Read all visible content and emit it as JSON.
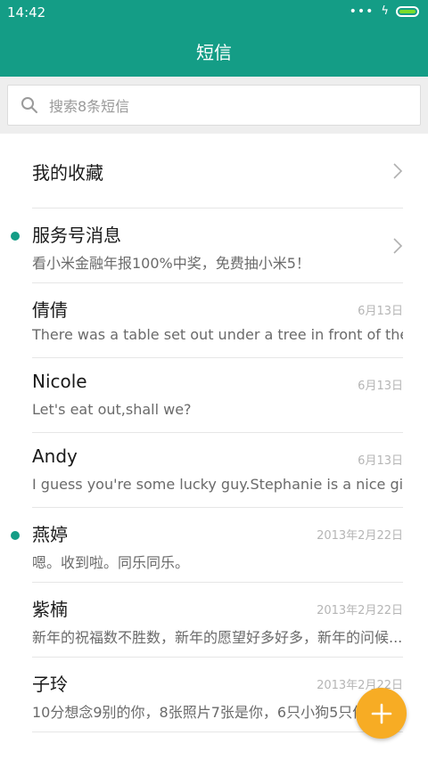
{
  "status": {
    "time": "14:42",
    "dots": "•••",
    "charging_symbol": "ϟ"
  },
  "app": {
    "title": "短信"
  },
  "search": {
    "placeholder": "搜索8条短信"
  },
  "colors": {
    "primary": "#149d86",
    "fab": "#f7ac24",
    "unread": "#149d86"
  },
  "rows": [
    {
      "name": "我的收藏",
      "preview": "",
      "date": "",
      "unread": false,
      "chevron": true
    },
    {
      "name": "服务号消息",
      "preview": "看小米金融年报100%中奖，免费抽小米5！",
      "date": "",
      "unread": true,
      "chevron": true
    },
    {
      "name": "倩倩",
      "preview": "There was a table set out under a tree in front of the ho...",
      "date": "6月13日",
      "unread": false,
      "chevron": false
    },
    {
      "name": "Nicole",
      "preview": "Let's eat out,shall we?",
      "date": "6月13日",
      "unread": false,
      "chevron": false
    },
    {
      "name": "Andy",
      "preview": "I guess you're some lucky guy.Stephanie is a nice girl.",
      "date": "6月13日",
      "unread": false,
      "chevron": false
    },
    {
      "name": "燕婷",
      "preview": "嗯。收到啦。同乐同乐。",
      "date": "2013年2月22日",
      "unread": true,
      "chevron": false
    },
    {
      "name": "紫楠",
      "preview": "新年的祝福数不胜数，新年的愿望好多好多，新年的问候...",
      "date": "2013年2月22日",
      "unread": false,
      "chevron": false
    },
    {
      "name": "子玲",
      "preview": "10分想念9别的你，8张照片7张是你，6只小狗5只像你",
      "date": "2013年2月22日",
      "unread": false,
      "chevron": false
    }
  ]
}
